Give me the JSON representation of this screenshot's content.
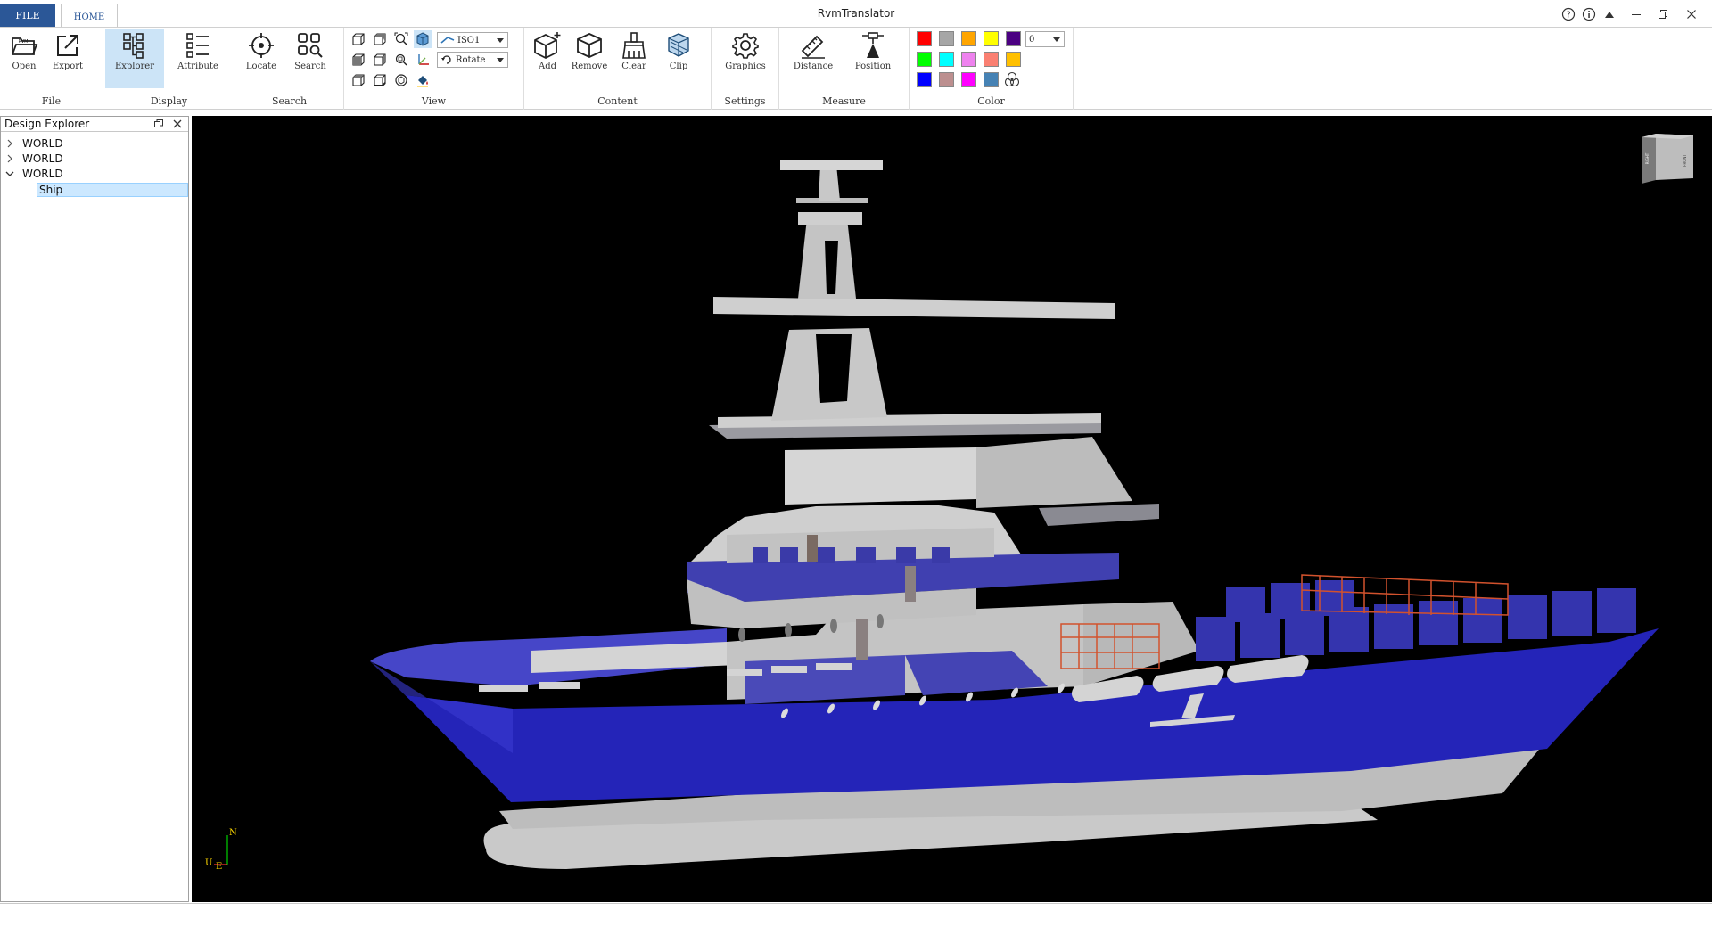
{
  "window": {
    "title": "RvmTranslator",
    "controls": [
      "help-icon",
      "info-icon",
      "collapse-ribbon-icon",
      "minimize-icon",
      "restore-icon",
      "close-icon"
    ]
  },
  "tabs": [
    {
      "label": "FILE",
      "active": false
    },
    {
      "label": "HOME",
      "active": true
    }
  ],
  "ribbon": {
    "groups": {
      "file": "File",
      "display": "Display",
      "search": "Search",
      "view": "View",
      "content": "Content",
      "settings": "Settings",
      "measure": "Measure",
      "color": "Color"
    },
    "buttons": {
      "open": "Open",
      "export": "Export",
      "explorer": "Explorer",
      "attribute": "Attribute",
      "locate": "Locate",
      "search": "Search",
      "add": "Add",
      "remove": "Remove",
      "clear": "Clear",
      "clip": "Clip",
      "graphics": "Graphics",
      "distance": "Distance",
      "position": "Position"
    },
    "open_icon_text": "RVM",
    "view_combo": "ISO1",
    "mode_combo": "Rotate",
    "color_index": "0",
    "swatches": [
      "#ff0000",
      "#a6a6a6",
      "#ffa500",
      "#ffff00",
      "#4b0082",
      "#00ff00",
      "#00ffff",
      "#ee82ee",
      "#fa8072",
      "#ffc000",
      "#0000ff",
      "#bc8f8f",
      "#ff00ff",
      "#4682b4"
    ]
  },
  "explorer": {
    "title": "Design Explorer",
    "tree": [
      {
        "label": "WORLD",
        "expanded": false
      },
      {
        "label": "WORLD",
        "expanded": false
      },
      {
        "label": "WORLD",
        "expanded": true
      },
      {
        "label": "Ship",
        "selected": true
      }
    ]
  },
  "viewport": {
    "viewcube": {
      "face_left": "RIGHT",
      "face_right": "FRONT"
    },
    "axes": {
      "north": "N",
      "up": "U",
      "east": "E"
    },
    "colors": {
      "hull": "#2424b8",
      "superstructure": "#c8c8c8",
      "background": "#000000",
      "railing": "#d2522d"
    }
  }
}
